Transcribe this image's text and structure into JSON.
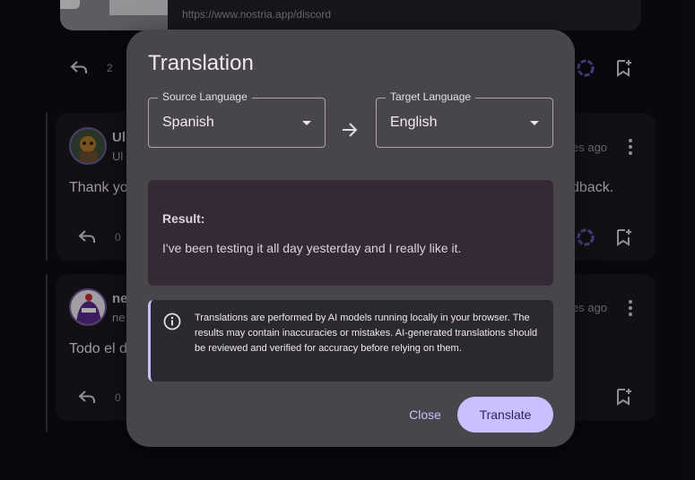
{
  "background": {
    "link_preview": {
      "url": "https://www.nostria.app/discord"
    },
    "top_actions": {
      "reply_count": "2"
    },
    "posts": [
      {
        "name": "Ul",
        "subname": "Ul",
        "time": "es ago",
        "text_left": "Thank yo",
        "text_right": "dback.",
        "reply_count": "0"
      },
      {
        "name": "ne",
        "subname": "ne",
        "time": "es ago",
        "text_left": "Todo el d",
        "reply_count": "0"
      }
    ]
  },
  "dialog": {
    "title": "Translation",
    "source": {
      "label": "Source Language",
      "value": "Spanish"
    },
    "target": {
      "label": "Target Language",
      "value": "English"
    },
    "result": {
      "label": "Result:",
      "text": "I've been testing it all day yesterday and I really like it."
    },
    "info_notice": "Translations are performed by AI models running locally in your browser. The results may contain inaccuracies or mistakes. AI-generated translations should be reviewed and verified for accuracy before relying on them.",
    "buttons": {
      "close": "Close",
      "translate": "Translate"
    }
  },
  "colors": {
    "primary": "#cbbfff",
    "dialog_bg": "#48464b",
    "page_bg": "#0f0d14"
  }
}
